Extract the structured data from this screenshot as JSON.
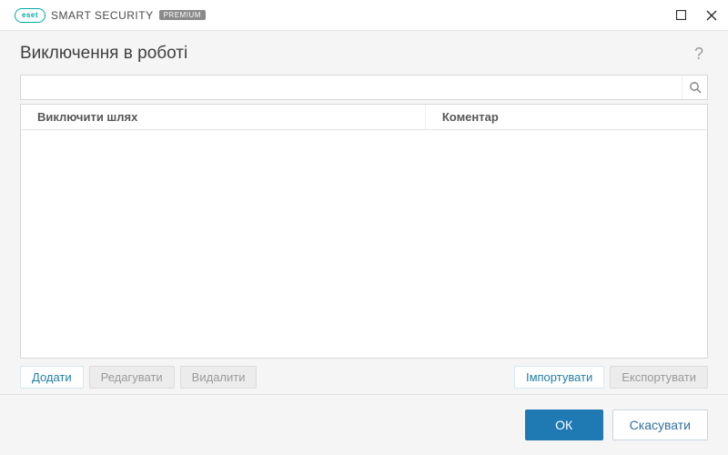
{
  "brand": {
    "logo_text": "eset",
    "product": "SMART SECURITY",
    "badge": "PREMIUM"
  },
  "header": {
    "title": "Виключення в роботі"
  },
  "search": {
    "value": "",
    "placeholder": ""
  },
  "columns": {
    "path": "Виключити шлях",
    "comment": "Коментар"
  },
  "rows": [],
  "actions": {
    "add": "Додати",
    "edit": "Редагувати",
    "delete": "Видалити",
    "import": "Імпортувати",
    "export": "Експортувати"
  },
  "footer": {
    "ok": "ОК",
    "cancel": "Скасувати"
  }
}
